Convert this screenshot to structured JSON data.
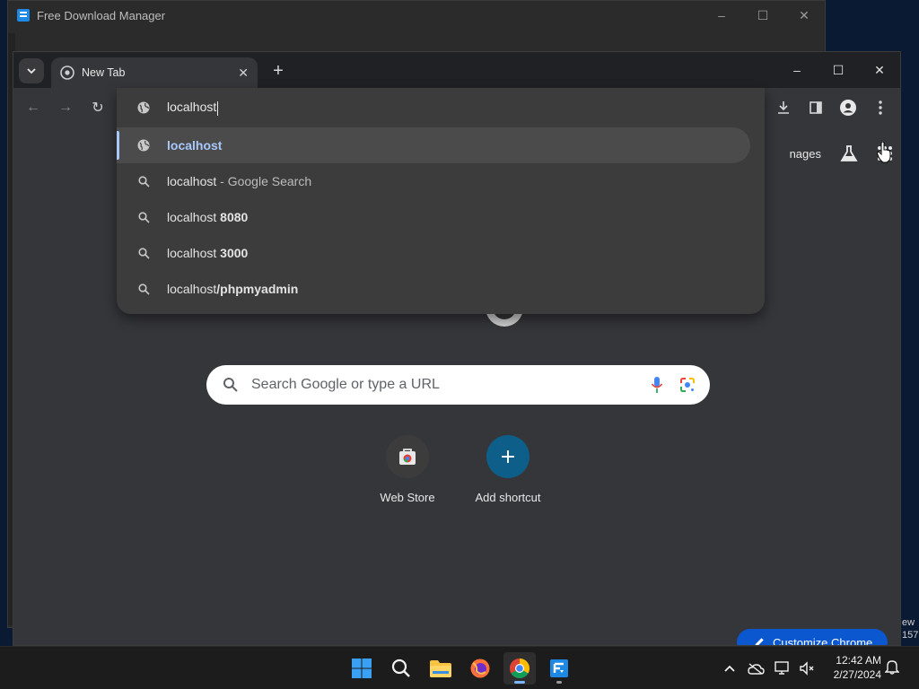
{
  "fdm": {
    "title": "Free Download Manager"
  },
  "chrome": {
    "tab_title": "New Tab",
    "omnibox": {
      "typed": "localhost",
      "suggestions": [
        {
          "main": "localhost",
          "suffix": "",
          "icon": "globe-icon"
        },
        {
          "main": "localhost",
          "suffix": " - Google Search",
          "icon": "search-icon"
        },
        {
          "main": "localhost ",
          "suffix": "8080",
          "icon": "search-icon"
        },
        {
          "main": "localhost ",
          "suffix": "3000",
          "icon": "search-icon"
        },
        {
          "main": "localhost",
          "suffix": "/phpmyadmin",
          "icon": "search-icon"
        }
      ]
    },
    "ntp": {
      "images_link": "nages",
      "search_placeholder": "Search Google or type a URL",
      "shortcuts": [
        {
          "label": "Web Store"
        },
        {
          "label": "Add shortcut"
        }
      ],
      "customize_label": "Customize Chrome"
    }
  },
  "desktop": {
    "right_text_1": "ew",
    "right_text_2": "157"
  },
  "taskbar": {
    "time": "12:42 AM",
    "date": "2/27/2024"
  },
  "colors": {
    "accent": "#a8c7fa",
    "chrome_bg": "#35363a",
    "dropdown_bg": "#3c3c3c"
  }
}
